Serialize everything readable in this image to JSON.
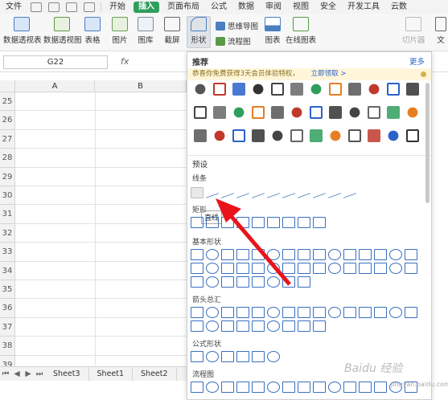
{
  "menubar": {
    "file": "文件",
    "start": "开始",
    "insert": "插入",
    "layout": "页面布局",
    "formula": "公式",
    "data": "数据",
    "review": "审阅",
    "view": "视图",
    "security": "安全",
    "dev": "开发工具",
    "cloud": "云数"
  },
  "ribbon": {
    "pivot_table": "数据透视表",
    "pivot_chart": "数据透视图",
    "table": "表格",
    "picture": "图片",
    "gallery": "图库",
    "screenshot": "截屏",
    "shape": "形状",
    "mind_map": "思维导图",
    "flowchart": "流程图",
    "chart": "图表",
    "online_chart": "在线图表",
    "slicer": "切片器",
    "text": "文"
  },
  "formula_bar": {
    "cell_ref": "G22",
    "fx": "fx"
  },
  "grid": {
    "columns": [
      "A",
      "B"
    ],
    "rows": [
      "25",
      "26",
      "27",
      "28",
      "29",
      "30",
      "31",
      "32",
      "33",
      "34",
      "35",
      "36",
      "37",
      "38",
      "39"
    ]
  },
  "sheet_tabs": [
    "Sheet3",
    "Sheet1",
    "Sheet2"
  ],
  "panel": {
    "recommend_title": "推荐",
    "more": "更多",
    "banner_text": "恭喜你免费获得3天会员体验特权，",
    "banner_link": "立即领取 >",
    "preset_title": "预设",
    "lines": "线条",
    "rect": "矩形",
    "tooltip": "直线",
    "basic_shapes": "基本形状",
    "arrows": "箭头总汇",
    "formula_shapes": "公式形状",
    "flowchart": "流程图"
  },
  "watermark": {
    "main": "Baidu 经验",
    "sub": "jingyan.baidu.com"
  },
  "colors": {
    "accent_green": "#2f9e5d",
    "shape_blue": "#3a6fbf",
    "arrow_red": "#e8141a"
  }
}
